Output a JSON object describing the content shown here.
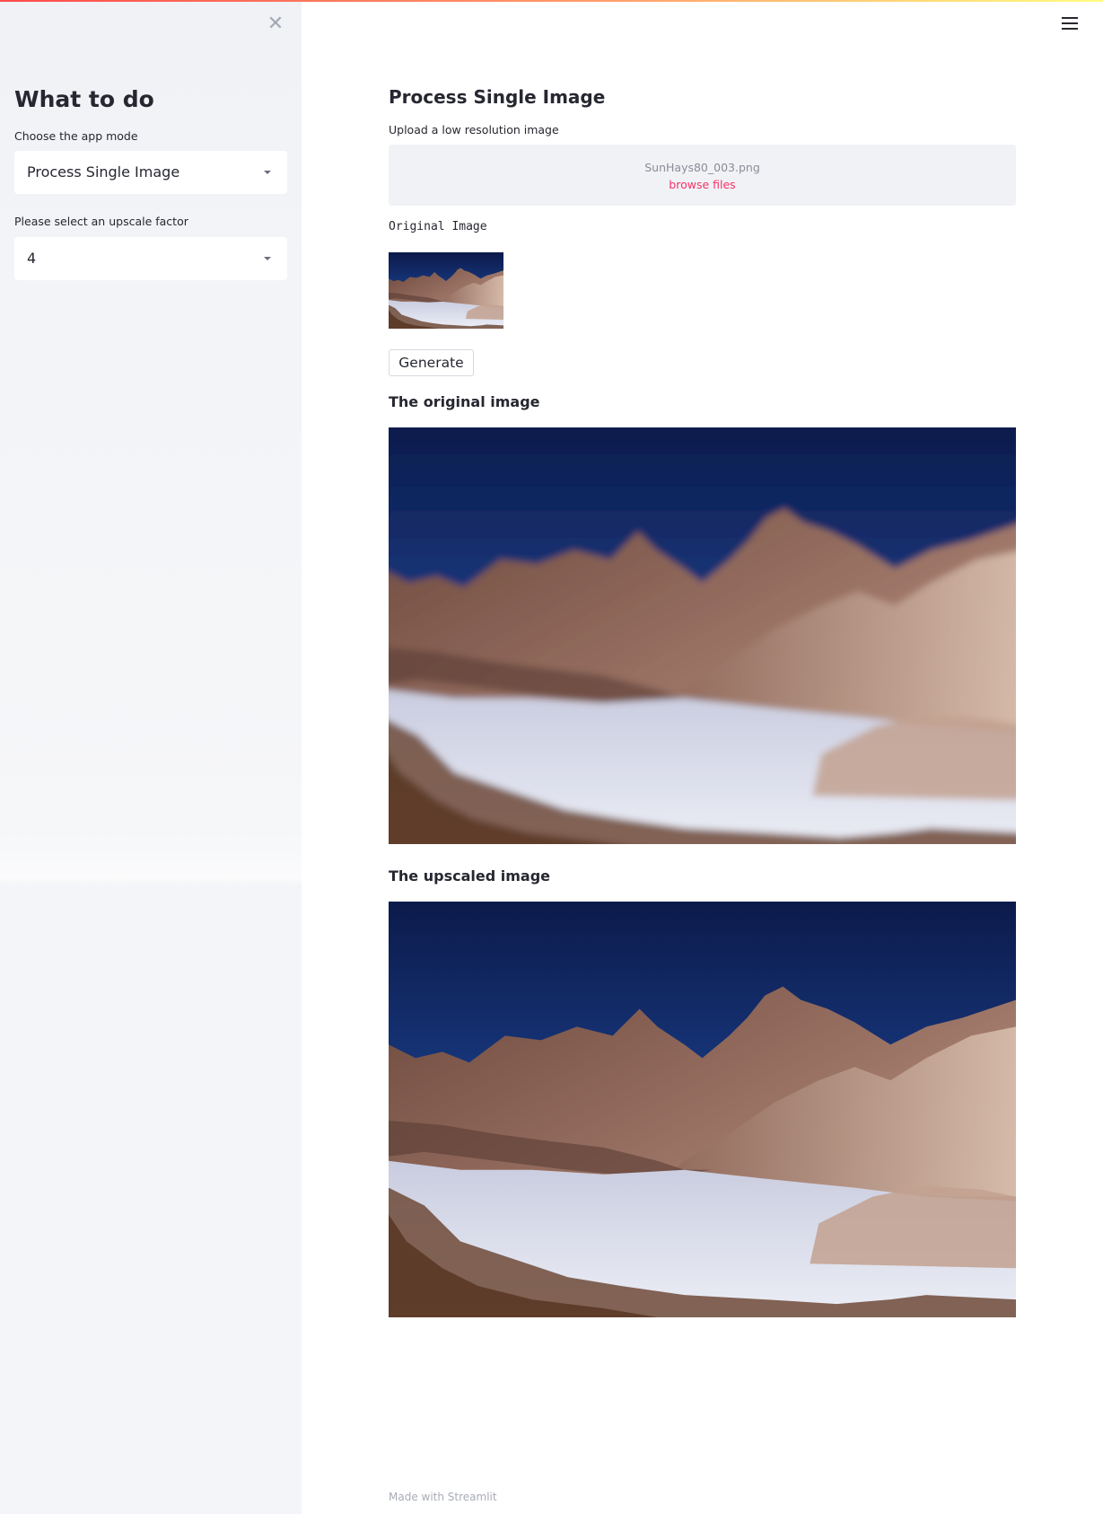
{
  "colors": {
    "accent": "#f63366",
    "sidebar_bg": "#f0f2f6",
    "text": "#262730",
    "muted": "#8a8d96"
  },
  "sidebar": {
    "close_icon": "close-icon",
    "title": "What to do",
    "app_mode": {
      "label": "Choose the app mode",
      "selected": "Process Single Image"
    },
    "upscale": {
      "label": "Please select an upscale factor",
      "selected": "4"
    }
  },
  "header": {
    "menu_icon": "hamburger-menu-icon"
  },
  "main": {
    "title": "Process Single Image",
    "upload": {
      "label": "Upload a low resolution image",
      "file_name": "SunHays80_003.png",
      "browse_label": "browse files"
    },
    "original_caption": "Original Image",
    "generate_label": "Generate",
    "original_heading": "The original image",
    "upscaled_heading": "The upscaled image"
  },
  "footer": {
    "prefix": "Made with ",
    "link": "Streamlit"
  }
}
